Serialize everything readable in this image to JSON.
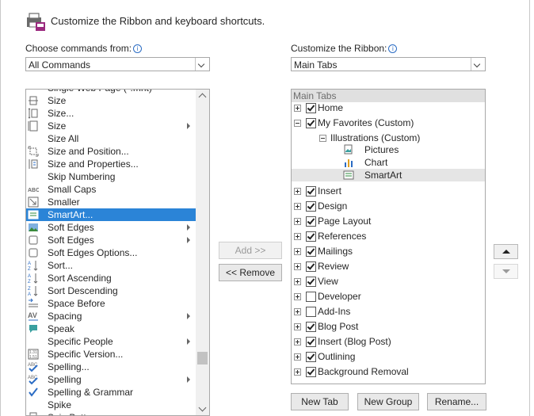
{
  "header": {
    "title": "Customize the Ribbon and keyboard shortcuts."
  },
  "left": {
    "label": "Choose commands from:",
    "dropdown_value": "All Commands",
    "items": [
      {
        "label": "Single Web Page (*.mht)",
        "icon": "web-page-icon",
        "submenu": false,
        "selected": false
      },
      {
        "label": "Size",
        "icon": "size-icon",
        "submenu": false,
        "selected": false
      },
      {
        "label": "Size...",
        "icon": "size-dialog-icon",
        "submenu": false,
        "selected": false
      },
      {
        "label": "Size",
        "icon": "page-size-icon",
        "submenu": true,
        "selected": false
      },
      {
        "label": "Size All",
        "icon": "",
        "submenu": false,
        "selected": false
      },
      {
        "label": "Size and Position...",
        "icon": "size-position-icon",
        "submenu": false,
        "selected": false
      },
      {
        "label": "Size and Properties...",
        "icon": "size-properties-icon",
        "submenu": false,
        "selected": false
      },
      {
        "label": "Skip Numbering",
        "icon": "",
        "submenu": false,
        "selected": false
      },
      {
        "label": "Small Caps",
        "icon": "small-caps-icon",
        "submenu": false,
        "selected": false
      },
      {
        "label": "Smaller",
        "icon": "smaller-icon",
        "submenu": false,
        "selected": false
      },
      {
        "label": "SmartArt...",
        "icon": "smartart-icon",
        "submenu": false,
        "selected": true
      },
      {
        "label": "Soft Edges",
        "icon": "soft-edges-picture-icon",
        "submenu": true,
        "selected": false
      },
      {
        "label": "Soft Edges",
        "icon": "soft-edges-shape-icon",
        "submenu": true,
        "selected": false
      },
      {
        "label": "Soft Edges Options...",
        "icon": "soft-edges-options-icon",
        "submenu": false,
        "selected": false
      },
      {
        "label": "Sort...",
        "icon": "sort-icon",
        "submenu": false,
        "selected": false
      },
      {
        "label": "Sort Ascending",
        "icon": "sort-ascending-icon",
        "submenu": false,
        "selected": false
      },
      {
        "label": "Sort Descending",
        "icon": "sort-descending-icon",
        "submenu": false,
        "selected": false
      },
      {
        "label": "Space Before",
        "icon": "space-before-icon",
        "submenu": false,
        "selected": false
      },
      {
        "label": "Spacing",
        "icon": "spacing-av-icon",
        "submenu": true,
        "selected": false
      },
      {
        "label": "Speak",
        "icon": "speak-icon",
        "submenu": false,
        "selected": false
      },
      {
        "label": "Specific People",
        "icon": "",
        "submenu": true,
        "selected": false
      },
      {
        "label": "Specific Version...",
        "icon": "specific-version-icon",
        "submenu": false,
        "selected": false
      },
      {
        "label": "Spelling...",
        "icon": "spelling-abc-icon",
        "submenu": false,
        "selected": false
      },
      {
        "label": "Spelling",
        "icon": "spelling-check-icon",
        "submenu": true,
        "selected": false
      },
      {
        "label": "Spelling & Grammar",
        "icon": "spelling-grammar-icon",
        "submenu": false,
        "selected": false
      },
      {
        "label": "Spike",
        "icon": "",
        "submenu": false,
        "selected": false
      },
      {
        "label": "Spin Button",
        "icon": "spin-button-icon",
        "submenu": false,
        "selected": false
      }
    ]
  },
  "middle": {
    "add_label": "Add >>",
    "remove_label": "<< Remove"
  },
  "right": {
    "label": "Customize the Ribbon:",
    "dropdown_value": "Main Tabs",
    "tree_header": "Main Tabs",
    "tree": [
      {
        "label": "Home",
        "level": 0,
        "expander": "plus",
        "checked": true
      },
      {
        "label": "My Favorites (Custom)",
        "level": 0,
        "expander": "minus",
        "checked": true
      },
      {
        "label": "Illustrations (Custom)",
        "level": 1,
        "expander": "minus",
        "checked": null
      },
      {
        "label": "Pictures",
        "level": 2,
        "expander": null,
        "checked": null,
        "icon": "pictures-icon"
      },
      {
        "label": "Chart",
        "level": 2,
        "expander": null,
        "checked": null,
        "icon": "chart-icon"
      },
      {
        "label": "SmartArt",
        "level": 2,
        "expander": null,
        "checked": null,
        "icon": "smartart-icon",
        "highlight": true
      },
      {
        "label": "Insert",
        "level": 0,
        "expander": "plus",
        "checked": true
      },
      {
        "label": "Design",
        "level": 0,
        "expander": "plus",
        "checked": true
      },
      {
        "label": "Page Layout",
        "level": 0,
        "expander": "plus",
        "checked": true
      },
      {
        "label": "References",
        "level": 0,
        "expander": "plus",
        "checked": true
      },
      {
        "label": "Mailings",
        "level": 0,
        "expander": "plus",
        "checked": true
      },
      {
        "label": "Review",
        "level": 0,
        "expander": "plus",
        "checked": true
      },
      {
        "label": "View",
        "level": 0,
        "expander": "plus",
        "checked": true
      },
      {
        "label": "Developer",
        "level": 0,
        "expander": "plus",
        "checked": false
      },
      {
        "label": "Add-Ins",
        "level": 0,
        "expander": "plus",
        "checked": false
      },
      {
        "label": "Blog Post",
        "level": 0,
        "expander": "plus",
        "checked": true
      },
      {
        "label": "Insert (Blog Post)",
        "level": 0,
        "expander": "plus",
        "checked": true
      },
      {
        "label": "Outlining",
        "level": 0,
        "expander": "plus",
        "checked": true
      },
      {
        "label": "Background Removal",
        "level": 0,
        "expander": "plus",
        "checked": true
      }
    ],
    "new_tab_label": "New Tab",
    "new_group_label": "New Group",
    "rename_label": "Rename..."
  },
  "colors": {
    "selection": "#2b84d7",
    "accent_info": "#2b6cc4",
    "tree_highlight": "#e5e5e5"
  }
}
